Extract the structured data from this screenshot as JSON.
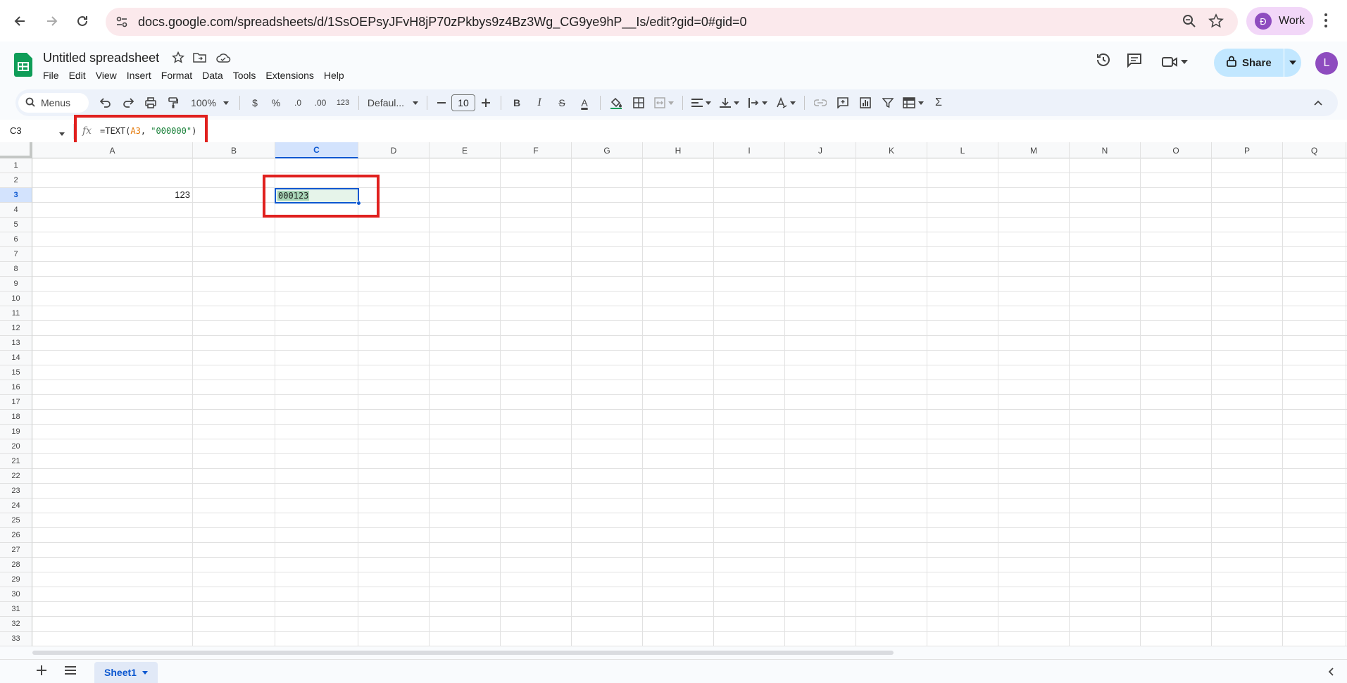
{
  "browser": {
    "url": "docs.google.com/spreadsheets/d/1SsOEPsyJFvH8jP70zPkbys9z4Bz3Wg_CG9ye9hP__Is/edit?gid=0#gid=0",
    "profile_initial": "Đ",
    "profile_label": "Work"
  },
  "doc": {
    "title": "Untitled spreadsheet",
    "menus": [
      "File",
      "Edit",
      "View",
      "Insert",
      "Format",
      "Data",
      "Tools",
      "Extensions",
      "Help"
    ],
    "share_label": "Share",
    "user_initial": "L"
  },
  "toolbar": {
    "search_label": "Menus",
    "zoom": "100%",
    "currency": "$",
    "percent": "%",
    "dec_decrease": ".0",
    "dec_increase": ".00",
    "number_format": "123",
    "font": "Defaul...",
    "font_size": "10",
    "bold": "B",
    "italic": "I",
    "strike": "S",
    "text_color": "A",
    "sum": "Σ"
  },
  "formula_bar": {
    "name_box": "C3",
    "fx": "fx",
    "formula_prefix": "=TEXT(",
    "formula_ref": "A3",
    "formula_mid": ", ",
    "formula_str": "\"000000\"",
    "formula_suffix": ")"
  },
  "grid": {
    "columns": [
      "A",
      "B",
      "C",
      "D",
      "E",
      "F",
      "G",
      "H",
      "I",
      "J",
      "K",
      "L",
      "M",
      "N",
      "O",
      "P",
      "Q"
    ],
    "rows": [
      "1",
      "2",
      "3",
      "4",
      "5",
      "6",
      "7",
      "8",
      "9",
      "10",
      "11",
      "12",
      "13",
      "14",
      "15",
      "16",
      "17",
      "18",
      "19",
      "20",
      "21",
      "22",
      "23",
      "24",
      "25",
      "26",
      "27",
      "28",
      "29",
      "30",
      "31",
      "32",
      "33"
    ],
    "selected_column": "C",
    "selected_row": "3",
    "cells": {
      "A3": "123",
      "C3": "000123"
    }
  },
  "sheets": {
    "tabs": [
      "Sheet1"
    ]
  },
  "colors": {
    "accent": "#0b57d0",
    "highlight_box": "#e0201e",
    "sheets_green": "#0f9d58"
  }
}
